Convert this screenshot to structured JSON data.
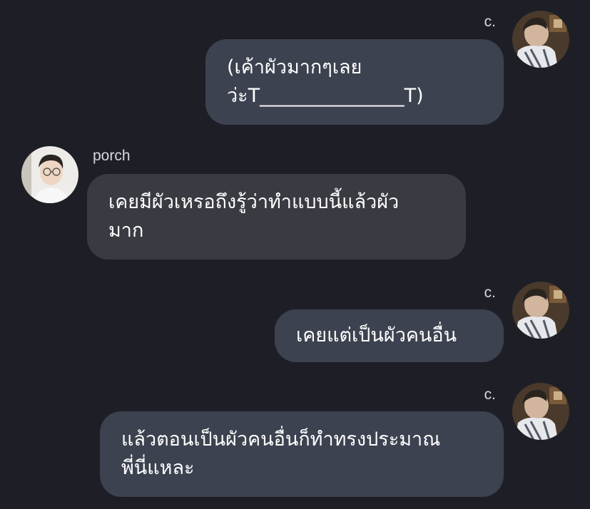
{
  "messages": [
    {
      "sender": "c.",
      "text": "(เค้าผัวมากๆเลย\nว่ะT_______________T)"
    },
    {
      "sender": "porch",
      "text": "เคยมีผัวเหรอถึงรู้ว่าทำแบบนี้แล้วผัว\nมาก"
    },
    {
      "sender": "c.",
      "text": "เคยแต่เป็นผัวคนอื่น"
    },
    {
      "sender": "c.",
      "text": "แล้วตอนเป็นผัวคนอื่นก็ทำทรงประมาณ\nพี่นี่แหละ"
    }
  ],
  "colors": {
    "background": "#1e1f26",
    "bubble_outgoing": "#3d4250",
    "bubble_incoming": "#3a3b42",
    "text": "#ffffff",
    "name": "#d7d8de"
  }
}
